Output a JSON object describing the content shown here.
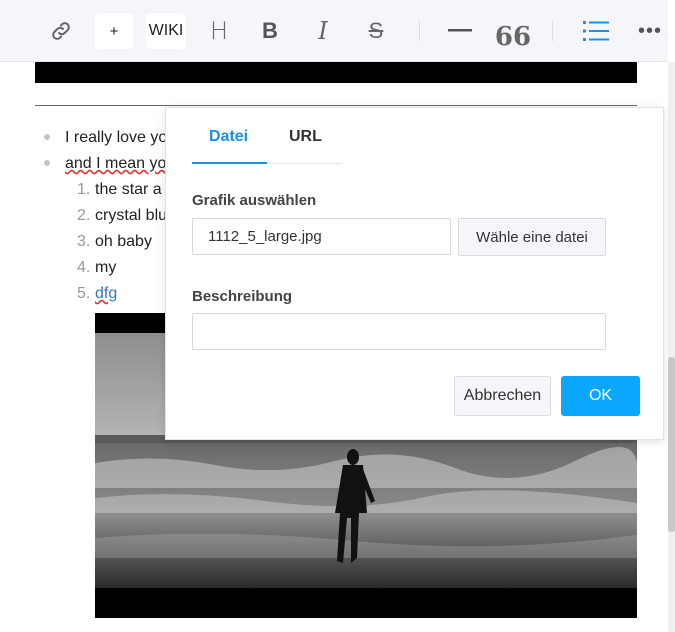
{
  "toolbar": {
    "plus_label": "+",
    "wiki_label": "WIKI",
    "heading_label": "H",
    "bold_label": "B",
    "italic_label": "I",
    "strike_label": "S",
    "quote_label": "66",
    "more_label": "•••"
  },
  "content": {
    "bullets": [
      "I really love yo",
      "and I mean yo"
    ],
    "numbered": [
      {
        "num": "1.",
        "text": "the star a"
      },
      {
        "num": "2.",
        "text": "crystal blu"
      },
      {
        "num": "3.",
        "text": "oh baby"
      },
      {
        "num": "4.",
        "text": "my"
      },
      {
        "num": "5.",
        "text": "dfg"
      }
    ]
  },
  "dialog": {
    "tab_file": "Datei",
    "tab_url": "URL",
    "image_label": "Grafik auswählen",
    "file_value": "1112_5_large.jpg",
    "choose_button": "Wähle eine datei",
    "description_label": "Beschreibung",
    "description_value": "",
    "cancel_button": "Abbrechen",
    "ok_button": "OK"
  },
  "colors": {
    "accent": "#1a90e8",
    "ok_button": "#0aa7ff",
    "toolbar_bg": "#f5f6fa"
  }
}
